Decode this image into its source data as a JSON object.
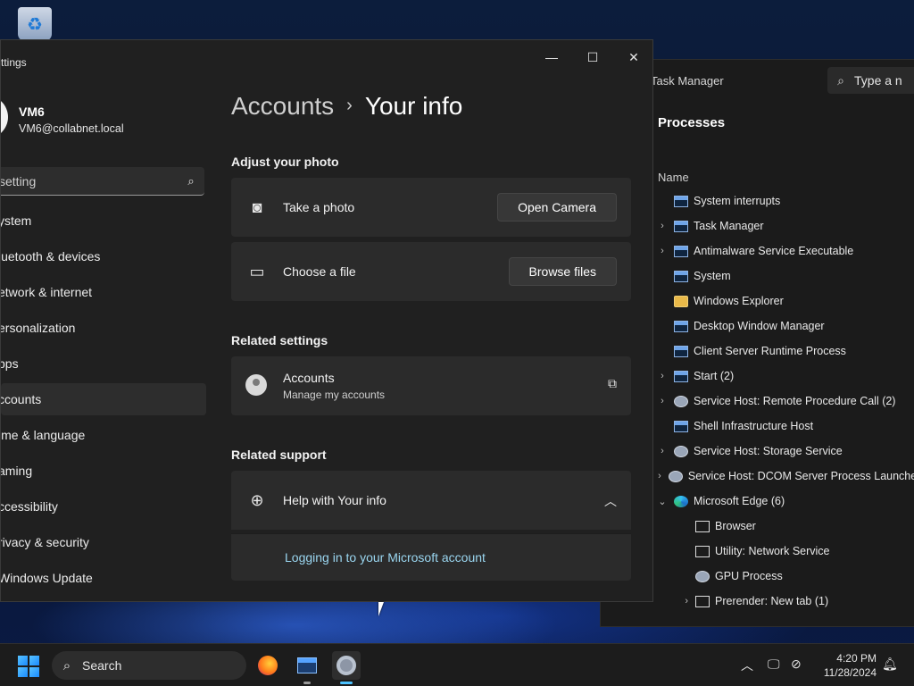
{
  "desktop": {
    "recycle_bin_icon": "recycle-bin-icon"
  },
  "task_manager": {
    "title": "Task Manager",
    "search_placeholder": "Type a n",
    "heading": "Processes",
    "column_name": "Name",
    "rows": [
      {
        "name": "System interrupts",
        "expand": "",
        "icon": "app"
      },
      {
        "name": "Task Manager",
        "expand": ">",
        "icon": "app"
      },
      {
        "name": "Antimalware Service Executable",
        "expand": ">",
        "icon": "app"
      },
      {
        "name": "System",
        "expand": "",
        "icon": "app"
      },
      {
        "name": "Windows Explorer",
        "expand": "",
        "icon": "folder"
      },
      {
        "name": "Desktop Window Manager",
        "expand": "",
        "icon": "app"
      },
      {
        "name": "Client Server Runtime Process",
        "expand": "",
        "icon": "app"
      },
      {
        "name": "Start (2)",
        "expand": ">",
        "icon": "app"
      },
      {
        "name": "Service Host: Remote Procedure Call (2)",
        "expand": ">",
        "icon": "gear"
      },
      {
        "name": "Shell Infrastructure Host",
        "expand": "",
        "icon": "app"
      },
      {
        "name": "Service Host: Storage Service",
        "expand": ">",
        "icon": "gear"
      },
      {
        "name": "Service Host: DCOM Server Process Launcher (",
        "expand": ">",
        "icon": "gear"
      },
      {
        "name": "Microsoft Edge (6)",
        "expand": "v",
        "icon": "edge"
      },
      {
        "name": "Browser",
        "expand": "",
        "icon": "doc",
        "indent": true
      },
      {
        "name": "Utility: Network Service",
        "expand": "",
        "icon": "doc",
        "indent": true
      },
      {
        "name": "GPU Process",
        "expand": "",
        "icon": "gear",
        "indent": true
      },
      {
        "name": "Prerender: New tab (1)",
        "expand": ">",
        "icon": "doc",
        "indent": true
      }
    ]
  },
  "settings": {
    "window_title": "ttings",
    "profile": {
      "name": "VM6",
      "email": "VM6@collabnet.local"
    },
    "search_placeholder": "setting",
    "nav": [
      {
        "label": "ystem",
        "active": false
      },
      {
        "label": "luetooth & devices",
        "active": false
      },
      {
        "label": "etwork & internet",
        "active": false
      },
      {
        "label": "ersonalization",
        "active": false
      },
      {
        "label": "pps",
        "active": false
      },
      {
        "label": "ccounts",
        "active": true
      },
      {
        "label": "ime & language",
        "active": false
      },
      {
        "label": "aming",
        "active": false
      },
      {
        "label": "ccessibility",
        "active": false
      },
      {
        "label": "rivacy & security",
        "active": false
      },
      {
        "label": "Windows Update",
        "active": false
      }
    ],
    "breadcrumb": {
      "parent": "Accounts",
      "separator": "›",
      "current": "Your info"
    },
    "adjust_photo": {
      "heading": "Adjust your photo",
      "take_photo_label": "Take a photo",
      "open_camera_label": "Open Camera",
      "choose_file_label": "Choose a file",
      "browse_files_label": "Browse files"
    },
    "related_settings": {
      "heading": "Related settings",
      "accounts_title": "Accounts",
      "accounts_subtitle": "Manage my accounts"
    },
    "related_support": {
      "heading": "Related support",
      "help_title": "Help with Your info",
      "link": "Logging in to your Microsoft account"
    }
  },
  "taskbar": {
    "search_label": "Search",
    "time": "4:20 PM",
    "date": "11/28/2024"
  }
}
